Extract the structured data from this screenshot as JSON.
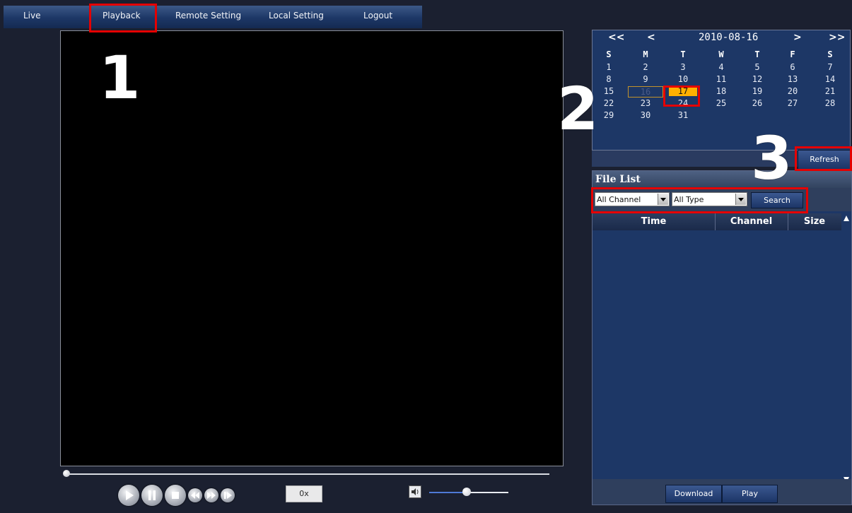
{
  "nav": {
    "items": [
      {
        "label": "Live"
      },
      {
        "label": "Playback"
      },
      {
        "label": "Remote Setting"
      },
      {
        "label": "Local Setting"
      },
      {
        "label": "Logout"
      }
    ]
  },
  "calendar": {
    "prev_year": "<<",
    "prev_month": "<",
    "title": "2010-08-16",
    "next_month": ">",
    "next_year": ">>",
    "weekdays": [
      "S",
      "M",
      "T",
      "W",
      "T",
      "F",
      "S"
    ],
    "today": "16",
    "selected": "17",
    "days": [
      "1",
      "2",
      "3",
      "4",
      "5",
      "6",
      "7",
      "8",
      "9",
      "10",
      "11",
      "12",
      "13",
      "14",
      "15",
      "16",
      "17",
      "18",
      "19",
      "20",
      "21",
      "22",
      "23",
      "24",
      "25",
      "26",
      "27",
      "28",
      "29",
      "30",
      "31"
    ]
  },
  "refresh_label": "Refresh",
  "file_list": {
    "title": "File List",
    "channel_select": "All Channel",
    "type_select": "All Type",
    "search_label": "Search",
    "columns": [
      "Time",
      "Channel",
      "Size"
    ],
    "download_label": "Download",
    "play_label": "Play"
  },
  "playback": {
    "speed": "0x",
    "progress": 0,
    "volume": 0.5
  },
  "annotations": [
    "1",
    "2",
    "3"
  ],
  "colors": {
    "accent_red": "#e50000",
    "selected_day": "#ffb000",
    "panel_blue": "#1d3766"
  }
}
